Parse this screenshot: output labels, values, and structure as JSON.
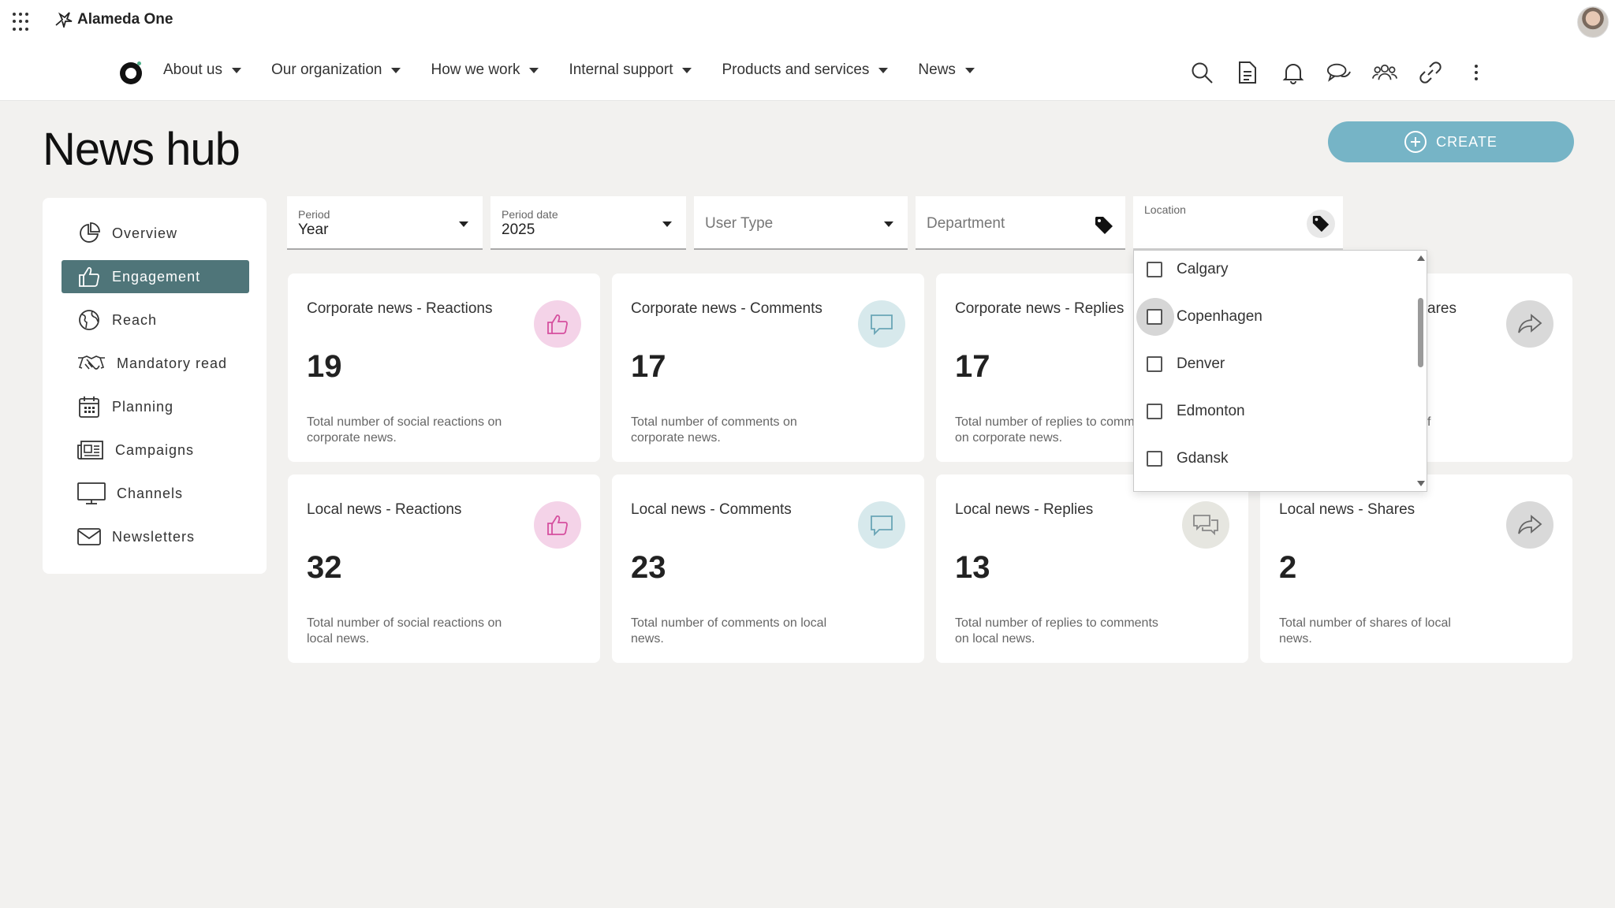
{
  "app": {
    "name": "Alameda One"
  },
  "nav": {
    "items": [
      {
        "label": "About us"
      },
      {
        "label": "Our organization"
      },
      {
        "label": "How we work"
      },
      {
        "label": "Internal support"
      },
      {
        "label": "Products and services"
      },
      {
        "label": "News"
      }
    ],
    "icons": [
      "search-icon",
      "document-icon",
      "bell-icon",
      "chat-icon",
      "people-icon",
      "link-icon",
      "more-vertical-icon"
    ]
  },
  "page": {
    "title": "News hub",
    "create_label": "CREATE"
  },
  "sidebar": {
    "items": [
      {
        "label": "Overview",
        "icon": "pie-chart-icon"
      },
      {
        "label": "Engagement",
        "icon": "thumbs-up-icon",
        "active": true
      },
      {
        "label": "Reach",
        "icon": "globe-icon"
      },
      {
        "label": "Mandatory read",
        "icon": "handshake-icon"
      },
      {
        "label": "Planning",
        "icon": "calendar-icon"
      },
      {
        "label": "Campaigns",
        "icon": "newspaper-icon"
      },
      {
        "label": "Channels",
        "icon": "monitor-icon"
      },
      {
        "label": "Newsletters",
        "icon": "envelope-icon"
      }
    ]
  },
  "filters": {
    "period": {
      "label": "Period",
      "value": "Year"
    },
    "period_date": {
      "label": "Period date",
      "value": "2025"
    },
    "user_type": {
      "placeholder": "User Type"
    },
    "department": {
      "placeholder": "Department"
    },
    "location": {
      "label": "Location"
    }
  },
  "location_dropdown": {
    "options": [
      "Calgary",
      "Copenhagen",
      "Denver",
      "Edmonton",
      "Gdansk"
    ]
  },
  "cards": {
    "corporate_reactions": {
      "title": "Corporate news - Reactions",
      "value": "19",
      "desc": "Total number of social reactions on corporate news."
    },
    "corporate_comments": {
      "title": "Corporate news - Comments",
      "value": "17",
      "desc": "Total number of comments on corporate news."
    },
    "corporate_replies": {
      "title": "Corporate news - Replies",
      "value": "17",
      "desc": "Total number of replies to comments on corporate news."
    },
    "corporate_shares": {
      "title": "ares",
      "desc": "f"
    },
    "local_reactions": {
      "title": "Local news - Reactions",
      "value": "32",
      "desc": "Total number of social reactions on local news."
    },
    "local_comments": {
      "title": "Local news - Comments",
      "value": "23",
      "desc": "Total number of comments on local news."
    },
    "local_replies": {
      "title": "Local news - Replies",
      "value": "13",
      "desc": "Total number of replies to comments on local news."
    },
    "local_shares": {
      "title": "Local news - Shares",
      "value": "2",
      "desc": "Total number of shares of local news."
    }
  },
  "colors": {
    "accent": "#76b4c6",
    "sidebar_active": "#4f7579",
    "reaction_bg": "#f4d3e8",
    "reaction_icon": "#d54f9e",
    "comment_bg": "#d7e9ec",
    "comment_icon": "#6aa5b6"
  }
}
